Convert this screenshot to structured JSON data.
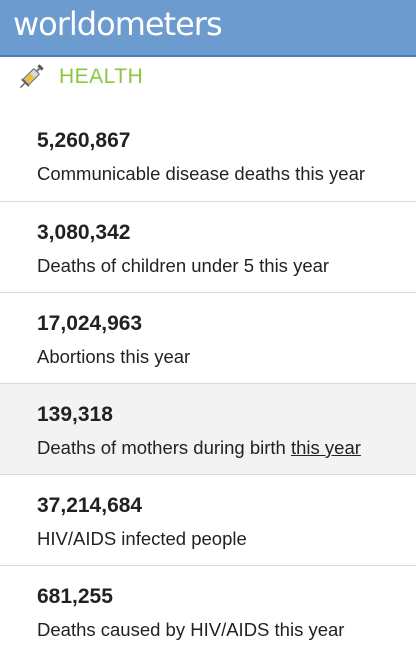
{
  "header": {
    "logo_text": "worldometers"
  },
  "section": {
    "icon": "syringe-icon",
    "title": "HEALTH"
  },
  "items": [
    {
      "value": "5,260,867",
      "label": "Communicable disease deaths this year"
    },
    {
      "value": "3,080,342",
      "label": "Deaths of children under 5 this year"
    },
    {
      "value": "17,024,963",
      "label": "Abortions this year"
    },
    {
      "value": "139,318",
      "label_main": "Deaths of mothers during birth ",
      "label_link": "this year"
    },
    {
      "value": "37,214,684",
      "label": "HIV/AIDS infected people"
    },
    {
      "value": "681,255",
      "label": "Deaths caused by HIV/AIDS this year"
    }
  ],
  "colors": {
    "header_bg": "#6b9bcf",
    "section_title": "#8cc63f",
    "shaded_row": "#f3f3f3"
  }
}
